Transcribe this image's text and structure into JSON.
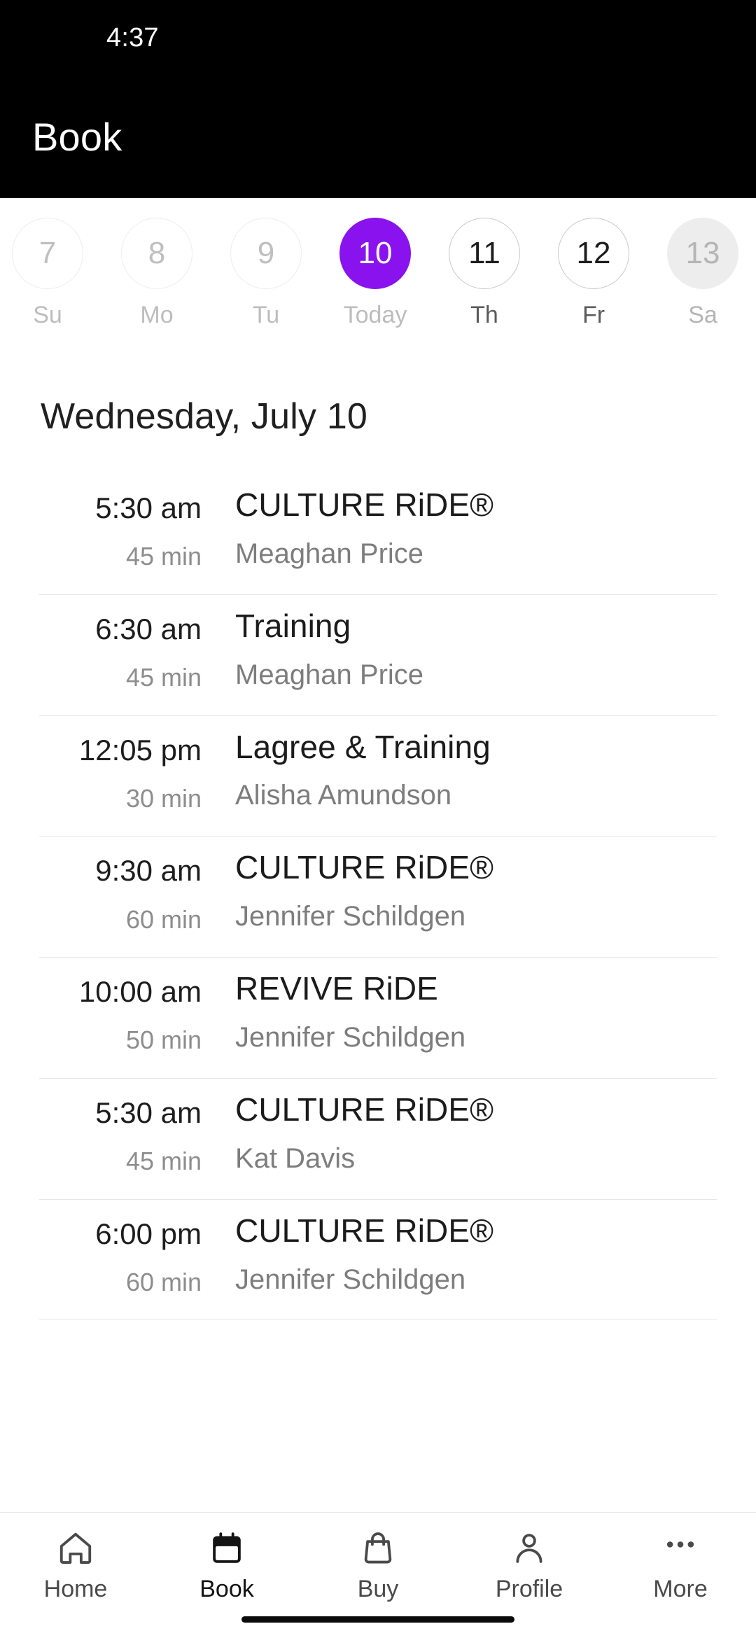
{
  "status_bar": {
    "time": "4:37"
  },
  "app_bar": {
    "title": "Book"
  },
  "date_strip": {
    "days": [
      {
        "num": "7",
        "label": "Su",
        "state": "past"
      },
      {
        "num": "8",
        "label": "Mo",
        "state": "past"
      },
      {
        "num": "9",
        "label": "Tu",
        "state": "past"
      },
      {
        "num": "10",
        "label": "Today",
        "state": "selected"
      },
      {
        "num": "11",
        "label": "Th",
        "state": "future"
      },
      {
        "num": "12",
        "label": "Fr",
        "state": "future"
      },
      {
        "num": "13",
        "label": "Sa",
        "state": "faded"
      }
    ],
    "selected_color": "#8a12ee"
  },
  "schedule": {
    "heading": "Wednesday, July 10",
    "classes": [
      {
        "time": "5:30 am",
        "duration": "45 min",
        "title": "CULTURE RiDE®",
        "instructor": "Meaghan Price"
      },
      {
        "time": "6:30 am",
        "duration": "45 min",
        "title": "Training",
        "instructor": "Meaghan Price"
      },
      {
        "time": "12:05 pm",
        "duration": "30 min",
        "title": "Lagree & Training",
        "instructor": "Alisha Amundson"
      },
      {
        "time": "9:30 am",
        "duration": "60 min",
        "title": "CULTURE RiDE®",
        "instructor": "Jennifer Schildgen"
      },
      {
        "time": "10:00 am",
        "duration": "50 min",
        "title": "REVIVE RiDE",
        "instructor": "Jennifer Schildgen"
      },
      {
        "time": "5:30 am",
        "duration": "45 min",
        "title": "CULTURE RiDE®",
        "instructor": "Kat Davis"
      },
      {
        "time": "6:00 pm",
        "duration": "60 min",
        "title": "CULTURE RiDE®",
        "instructor": "Jennifer Schildgen"
      }
    ]
  },
  "bottom_nav": {
    "items": [
      {
        "label": "Home",
        "icon": "home-icon",
        "active": false
      },
      {
        "label": "Book",
        "icon": "calendar-icon",
        "active": true
      },
      {
        "label": "Buy",
        "icon": "bag-icon",
        "active": false
      },
      {
        "label": "Profile",
        "icon": "person-icon",
        "active": false
      },
      {
        "label": "More",
        "icon": "more-dots-icon",
        "active": false
      }
    ]
  }
}
